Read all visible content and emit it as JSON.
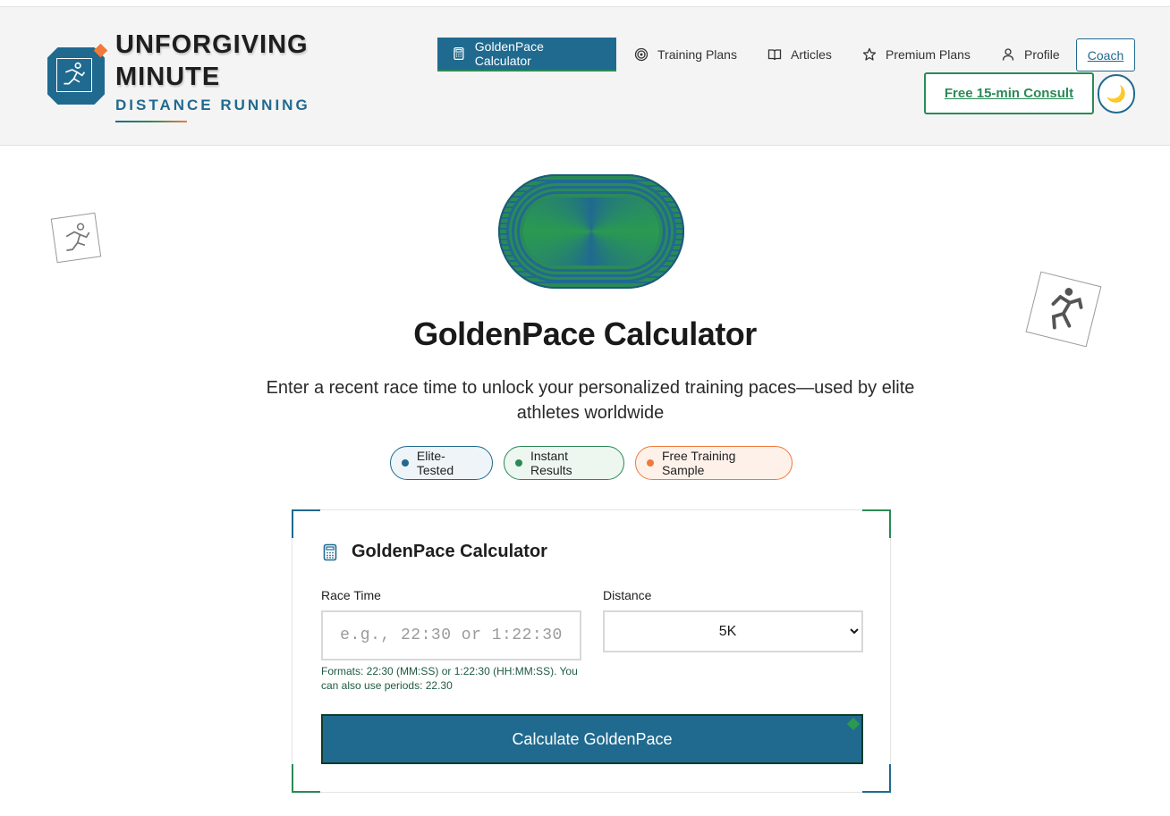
{
  "brand": {
    "title_line1": "UNFORGIVING",
    "title_line2": "MINUTE",
    "subtitle": "DISTANCE RUNNING"
  },
  "nav": {
    "items": [
      {
        "label": "GoldenPace Calculator",
        "icon": "calculator-icon",
        "active": true
      },
      {
        "label": "Training Plans",
        "icon": "target-icon",
        "active": false
      },
      {
        "label": "Articles",
        "icon": "book-icon",
        "active": false
      },
      {
        "label": "Premium Plans",
        "icon": "star-icon",
        "active": false
      },
      {
        "label": "Profile",
        "icon": "user-icon",
        "active": false
      }
    ],
    "coach_label": "Coach",
    "consult_label": "Free 15-min Consult",
    "theme_icon": "🌙"
  },
  "hero": {
    "title": "GoldenPace Calculator",
    "description": "Enter a recent race time to unlock your personalized training paces—used by elite athletes worldwide",
    "badges": [
      {
        "label": "Elite-Tested",
        "color": "#206a8f"
      },
      {
        "label": "Instant Results",
        "color": "#2a8a56"
      },
      {
        "label": "Free Training Sample",
        "color": "#f07a3a"
      }
    ]
  },
  "calculator": {
    "title": "GoldenPace Calculator",
    "race_time_label": "Race Time",
    "race_time_placeholder": "e.g., 22:30 or 1:22:30",
    "race_time_value": "",
    "hint": "Formats: 22:30 (MM:SS) or 1:22:30 (HH:MM:SS). You can also use periods: 22.30",
    "distance_label": "Distance",
    "distance_selected": "5K",
    "submit_label": "Calculate GoldenPace"
  },
  "colors": {
    "primary": "#206a8f",
    "green": "#2a8a56",
    "orange": "#f07a3a"
  }
}
